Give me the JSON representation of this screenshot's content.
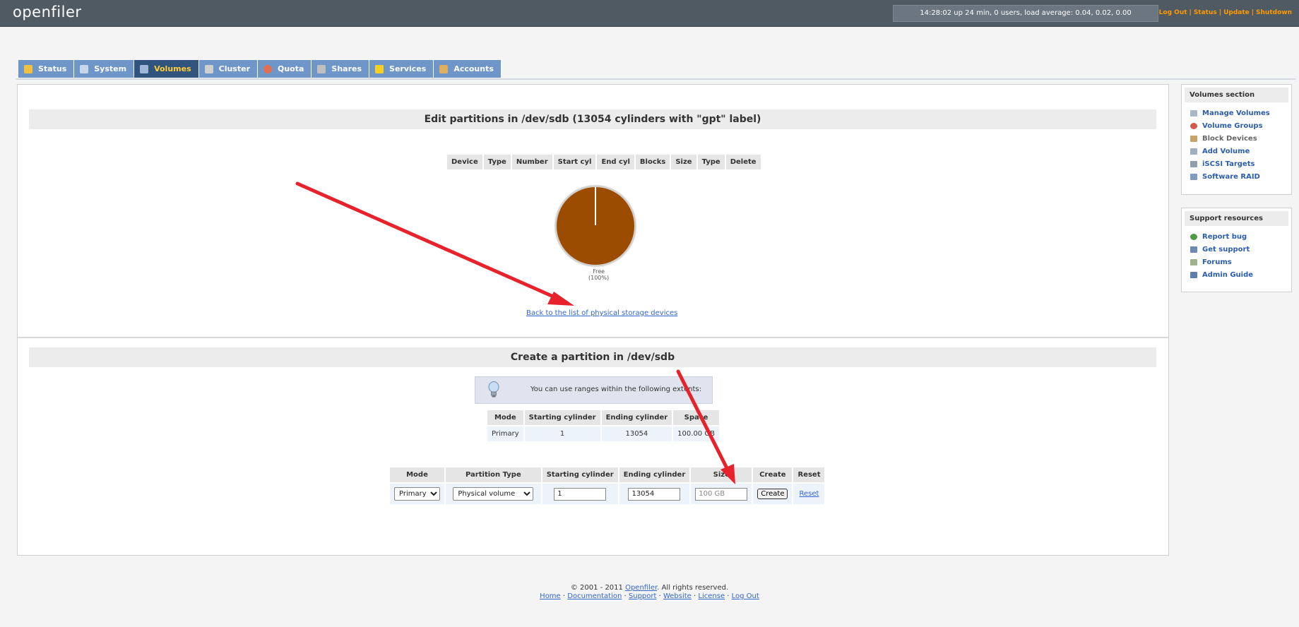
{
  "app": {
    "logo": "openfiler"
  },
  "status_bar": {
    "uptime": "14:28:02 up 24 min, 0 users, load average: 0.04, 0.02, 0.00"
  },
  "top_links": [
    "Log Out",
    "Status",
    "Update",
    "Shutdown"
  ],
  "tabs": [
    {
      "label": "Status",
      "icon": "status-icon",
      "color": "#f0c040"
    },
    {
      "label": "System",
      "icon": "system-icon",
      "color": "#c8d6e8"
    },
    {
      "label": "Volumes",
      "icon": "volumes-icon",
      "color": "#9fb8d8",
      "active": true
    },
    {
      "label": "Cluster",
      "icon": "cluster-icon",
      "color": "#d0d0d0"
    },
    {
      "label": "Quota",
      "icon": "quota-icon",
      "color": "#e07050"
    },
    {
      "label": "Shares",
      "icon": "shares-icon",
      "color": "#c0c0c0"
    },
    {
      "label": "Services",
      "icon": "services-icon",
      "color": "#f5d020"
    },
    {
      "label": "Accounts",
      "icon": "accounts-icon",
      "color": "#e0b060"
    }
  ],
  "edit_section": {
    "title": "Edit partitions in /dev/sdb (13054 cylinders with \"gpt\" label)",
    "columns": [
      "Device",
      "Type",
      "Number",
      "Start cyl",
      "End cyl",
      "Blocks",
      "Size",
      "Type",
      "Delete"
    ],
    "pie": {
      "label": "Free",
      "percent": "(100%)",
      "color": "#9c4c00"
    },
    "back_link": "Back to the list of physical storage devices"
  },
  "create_section": {
    "title": "Create a partition in /dev/sdb",
    "hint": "You can use ranges within the following extents:",
    "extents_columns": [
      "Mode",
      "Starting cylinder",
      "Ending cylinder",
      "Space"
    ],
    "extents_row": [
      "Primary",
      "1",
      "13054",
      "100.00 GB"
    ],
    "form_columns": [
      "Mode",
      "Partition Type",
      "Starting cylinder",
      "Ending cylinder",
      "Size",
      "Create",
      "Reset"
    ],
    "form": {
      "mode": "Primary",
      "partition_type": "Physical volume",
      "start": "1",
      "end": "13054",
      "size_placeholder": "100 GB",
      "create_label": "Create",
      "reset_label": "Reset"
    }
  },
  "volumes_section": {
    "title": "Volumes section",
    "items": [
      {
        "label": "Manage Volumes",
        "icon": "manage-volumes-icon"
      },
      {
        "label": "Volume Groups",
        "icon": "volume-groups-icon"
      },
      {
        "label": "Block Devices",
        "icon": "block-devices-icon"
      },
      {
        "label": "Add Volume",
        "icon": "add-volume-icon"
      },
      {
        "label": "iSCSI Targets",
        "icon": "iscsi-targets-icon"
      },
      {
        "label": "Software RAID",
        "icon": "software-raid-icon"
      }
    ]
  },
  "support_section": {
    "title": "Support resources",
    "items": [
      {
        "label": "Report bug",
        "icon": "report-bug-icon"
      },
      {
        "label": "Get support",
        "icon": "get-support-icon"
      },
      {
        "label": "Forums",
        "icon": "forums-icon"
      },
      {
        "label": "Admin Guide",
        "icon": "admin-guide-icon"
      }
    ]
  },
  "footer": {
    "copyright_pre": "© 2001 - 2011",
    "copyright_link": "Openfiler",
    "copyright_post": ". All rights reserved.",
    "links": [
      "Home",
      "Documentation",
      "Support",
      "Website",
      "License",
      "Log Out"
    ]
  },
  "colors": {
    "arrow": "#e8222b",
    "topbar": "#4f5a63",
    "tab": "#6e96c9",
    "tab_active": "#31547f"
  }
}
